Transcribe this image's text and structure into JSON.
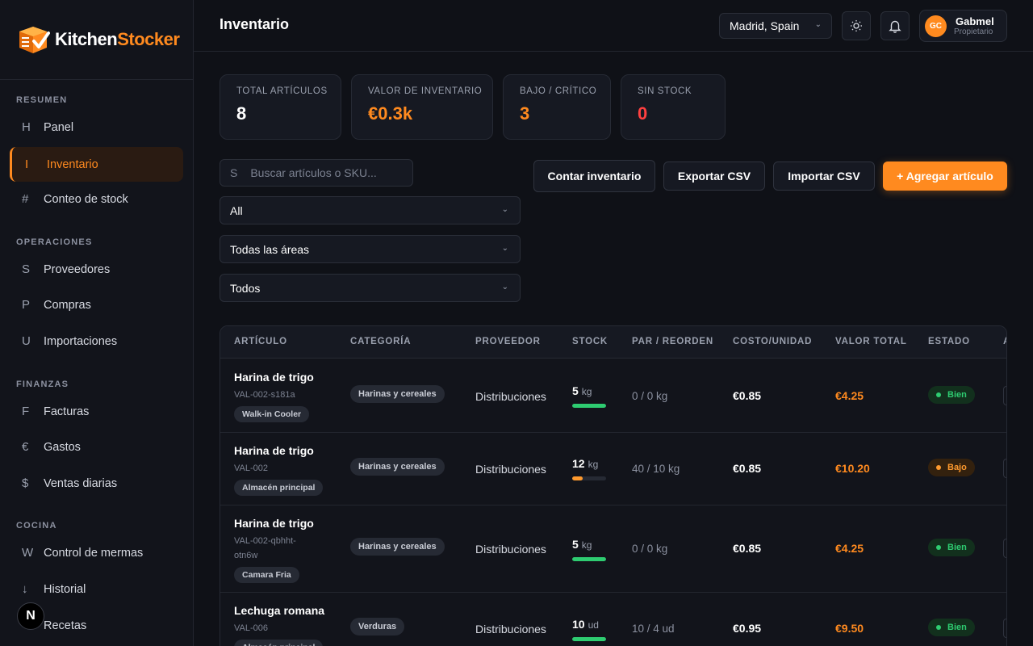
{
  "brand": {
    "name_a": "Kitchen",
    "name_b": "Stocker"
  },
  "sidebar": {
    "sections": [
      {
        "title": "RESUMEN"
      },
      {
        "title": "OPERACIONES"
      },
      {
        "title": "FINANZAS"
      },
      {
        "title": "COCINA"
      }
    ],
    "items": [
      {
        "glyph": "H",
        "label": "Panel"
      },
      {
        "glyph": "I",
        "label": "Inventario"
      },
      {
        "glyph": "#",
        "label": "Conteo de stock"
      },
      {
        "glyph": "S",
        "label": "Proveedores"
      },
      {
        "glyph": "P",
        "label": "Compras"
      },
      {
        "glyph": "U",
        "label": "Importaciones"
      },
      {
        "glyph": "F",
        "label": "Facturas"
      },
      {
        "glyph": "€",
        "label": "Gastos"
      },
      {
        "glyph": "$",
        "label": "Ventas diarias"
      },
      {
        "glyph": "W",
        "label": "Control de mermas"
      },
      {
        "glyph": "↓",
        "label": "Historial"
      },
      {
        "glyph": "",
        "label": "Recetas"
      }
    ],
    "next_badge": "N"
  },
  "header": {
    "title": "Inventario",
    "location": "Madrid, Spain",
    "user": {
      "initials": "GC",
      "name": "Gabmel",
      "role": "Propietario"
    }
  },
  "stats": [
    {
      "label": "TOTAL ARTÍCULOS",
      "value": "8",
      "color": "#ffffff"
    },
    {
      "label": "VALOR DE INVENTARIO",
      "value": "€0.3k",
      "color": "#ff8a1f"
    },
    {
      "label": "BAJO / CRÍTICO",
      "value": "3",
      "color": "#ff8a1f"
    },
    {
      "label": "SIN STOCK",
      "value": "0",
      "color": "#ff4040"
    }
  ],
  "filters": {
    "search_glyph": "S",
    "search_placeholder": "Buscar artículos o SKU...",
    "category": "All",
    "area": "Todas las áreas",
    "status": "Todos"
  },
  "actions": {
    "count": "Contar inventario",
    "export": "Exportar CSV",
    "import": "Importar CSV",
    "add": "+ Agregar artículo"
  },
  "table": {
    "columns": [
      "ARTÍCULO",
      "CATEGORÍA",
      "PROVEEDOR",
      "STOCK",
      "PAR / REORDEN",
      "COSTO/UNIDAD",
      "VALOR TOTAL",
      "ESTADO",
      "A"
    ],
    "rows": [
      {
        "name": "Harina de trigo",
        "sku": "VAL-002-s181a",
        "location": "Walk-in Cooler",
        "category": "Harinas y cereales",
        "supplier": "Distribuciones",
        "stock": "5",
        "unit": "kg",
        "level": 1.0,
        "bar_color": "#2ecc71",
        "par": "0 / 0 kg",
        "cost": "€0.85",
        "total": "€4.25",
        "status": "Bien",
        "status_kind": "ok"
      },
      {
        "name": "Harina de trigo",
        "sku": "VAL-002",
        "location": "Almacén principal",
        "category": "Harinas y cereales",
        "supplier": "Distribuciones",
        "stock": "12",
        "unit": "kg",
        "level": 0.3,
        "bar_color": "#ff9a2e",
        "par": "40 / 10 kg",
        "cost": "€0.85",
        "total": "€10.20",
        "status": "Bajo",
        "status_kind": "low"
      },
      {
        "name": "Harina de trigo",
        "sku": "VAL-002-qbhht-otn6w",
        "location": "Camara Fria",
        "category": "Harinas y cereales",
        "supplier": "Distribuciones",
        "stock": "5",
        "unit": "kg",
        "level": 1.0,
        "bar_color": "#2ecc71",
        "par": "0 / 0 kg",
        "cost": "€0.85",
        "total": "€4.25",
        "status": "Bien",
        "status_kind": "ok"
      },
      {
        "name": "Lechuga romana",
        "sku": "VAL-006",
        "location": "Almacén principal",
        "category": "Verduras",
        "supplier": "Distribuciones",
        "stock": "10",
        "unit": "ud",
        "level": 1.0,
        "bar_color": "#2ecc71",
        "par": "10 / 4 ud",
        "cost": "€0.95",
        "total": "€9.50",
        "status": "Bien",
        "status_kind": "ok"
      }
    ]
  }
}
